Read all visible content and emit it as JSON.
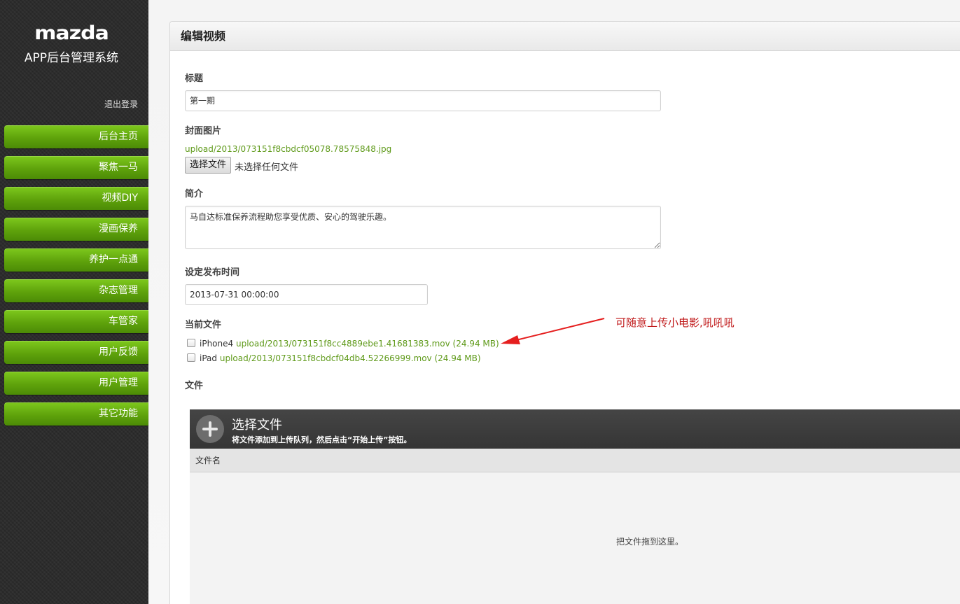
{
  "sidebar": {
    "logo_text": "mazda",
    "system_title": "APP后台管理系统",
    "logout_label": "退出登录",
    "items": [
      {
        "label": "后台主页"
      },
      {
        "label": "聚焦一马"
      },
      {
        "label": "视频DIY"
      },
      {
        "label": "漫画保养"
      },
      {
        "label": "养护一点通"
      },
      {
        "label": "杂志管理"
      },
      {
        "label": "车管家"
      },
      {
        "label": "用户反馈"
      },
      {
        "label": "用户管理"
      },
      {
        "label": "其它功能"
      }
    ]
  },
  "form": {
    "heading": "编辑视频",
    "title_label": "标题",
    "title_value": "第一期",
    "cover_label": "封面图片",
    "cover_path": "upload/2013/073151f8cbdcf05078.78575848.jpg",
    "choose_file_button": "选择文件",
    "no_file_text": "未选择任何文件",
    "intro_label": "简介",
    "intro_value": "马自达标准保养流程助您享受优质、安心的驾驶乐趣。",
    "publish_time_label": "设定发布时间",
    "publish_time_value": "2013-07-31 00:00:00",
    "current_files_label": "当前文件",
    "current_files": [
      {
        "device": "iPhone4",
        "path": "upload/2013/073151f8cc4889ebe1.41681383.mov (24.94 MB)"
      },
      {
        "device": "iPad",
        "path": "upload/2013/073151f8cbdcf04db4.52266999.mov (24.94 MB)"
      }
    ],
    "file_label": "文件"
  },
  "annotation": {
    "text": "可随意上传小电影,吼吼吼",
    "color": "#c0191a"
  },
  "uploader": {
    "title": "选择文件",
    "subtitle": "将文件添加到上传队列，然后点击“开始上传”按钮。",
    "column_filename": "文件名",
    "drop_hint": "把文件拖到这里。"
  },
  "colors": {
    "accent_green": "#5ea20b",
    "link_green": "#5f9a1a",
    "sidebar_bg": "#2a2a2a"
  }
}
